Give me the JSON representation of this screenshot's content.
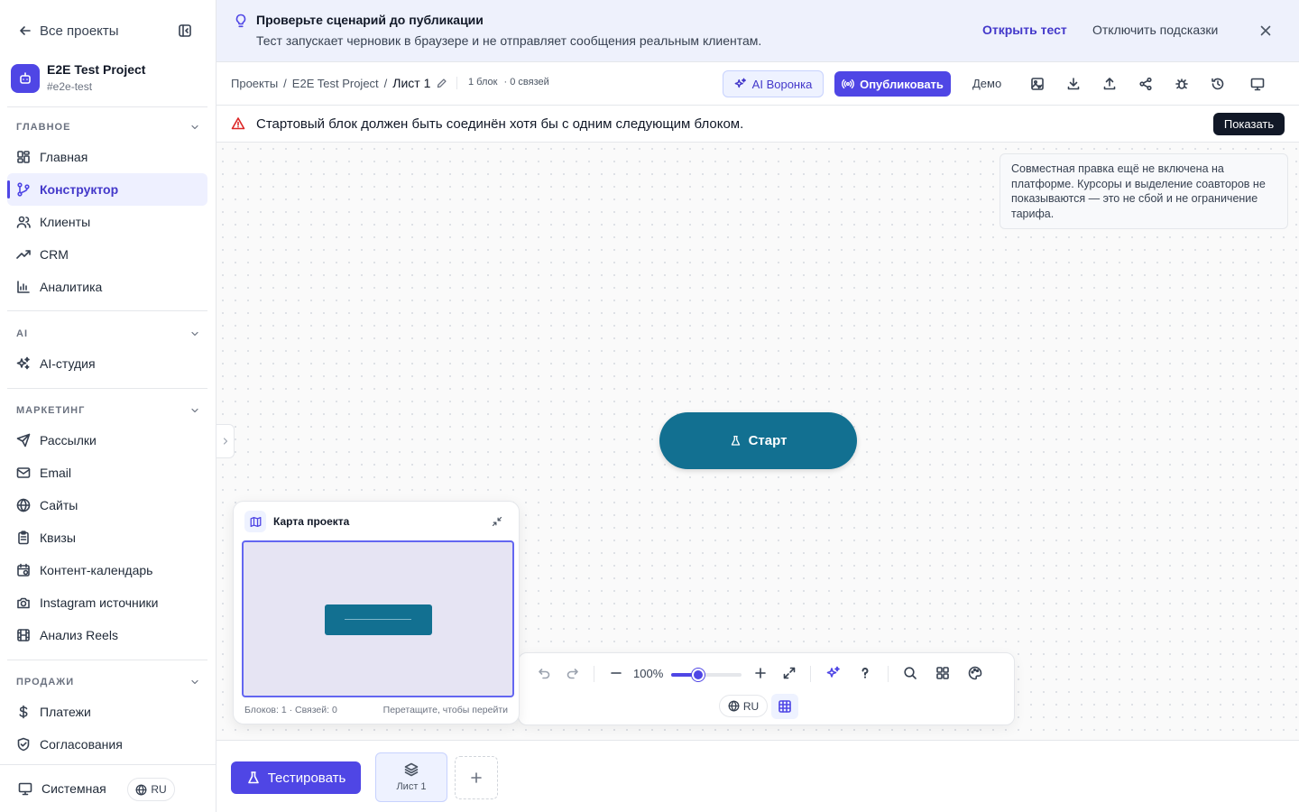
{
  "sidebar": {
    "back_label": "Все проекты",
    "project": {
      "name": "E2E Test Project",
      "tag": "#e2e-test"
    },
    "sections": [
      {
        "title": "ГЛАВНОЕ",
        "items": [
          {
            "label": "Главная",
            "icon": "dashboard-icon"
          },
          {
            "label": "Конструктор",
            "icon": "flow-icon",
            "active": true
          },
          {
            "label": "Клиенты",
            "icon": "users-icon"
          },
          {
            "label": "CRM",
            "icon": "trending-icon"
          },
          {
            "label": "Аналитика",
            "icon": "bar-chart-icon"
          }
        ]
      },
      {
        "title": "AI",
        "items": [
          {
            "label": "AI-студия",
            "icon": "sparkles-icon"
          }
        ]
      },
      {
        "title": "МАРКЕТИНГ",
        "items": [
          {
            "label": "Рассылки",
            "icon": "send-icon"
          },
          {
            "label": "Email",
            "icon": "mail-icon"
          },
          {
            "label": "Сайты",
            "icon": "globe-icon"
          },
          {
            "label": "Квизы",
            "icon": "clipboard-icon"
          },
          {
            "label": "Контент-календарь",
            "icon": "calendar-icon"
          },
          {
            "label": "Instagram источники",
            "icon": "camera-icon"
          },
          {
            "label": "Анализ Reels",
            "icon": "film-icon"
          }
        ]
      },
      {
        "title": "ПРОДАЖИ",
        "items": [
          {
            "label": "Платежи",
            "icon": "dollar-icon"
          },
          {
            "label": "Согласования",
            "icon": "shield-check-icon"
          }
        ]
      }
    ],
    "theme_label": "Системная",
    "lang": "RU"
  },
  "banner": {
    "title": "Проверьте сценарий до публикации",
    "text": "Тест запускает черновик в браузере и не отправляет сообщения реальным клиентам.",
    "open_test": "Открыть тест",
    "disable_hints": "Отключить подсказки"
  },
  "toolbar": {
    "breadcrumbs": [
      "Проекты",
      "E2E Test Project"
    ],
    "sheet_name": "Лист 1",
    "blocks_count": "1 блок",
    "links_count": "· 0 связей",
    "ai_funnel": "AI Воронка",
    "publish": "Опубликовать",
    "demo": "Демо"
  },
  "warning": {
    "text": "Стартовый блок должен быть соединён хотя бы с одним следующим блоком.",
    "button": "Показать",
    "color": "#dc2626"
  },
  "canvas": {
    "collab_notice": "Совместная правка ещё не включена на платформе. Курсоры и выделение соавторов не показываются — это не сбой и не ограничение тарифа.",
    "start_node": "Старт",
    "node_color": "#127091"
  },
  "minimap": {
    "title": "Карта проекта",
    "stats": "Блоков: 1 · Связей: 0",
    "hint": "Перетащите, чтобы перейти"
  },
  "zoom": {
    "value": "100%",
    "level": 0.38,
    "lang": "RU"
  },
  "bottom": {
    "test_button": "Тестировать",
    "sheet_tab": "Лист 1"
  },
  "accent": "#4f46e5"
}
